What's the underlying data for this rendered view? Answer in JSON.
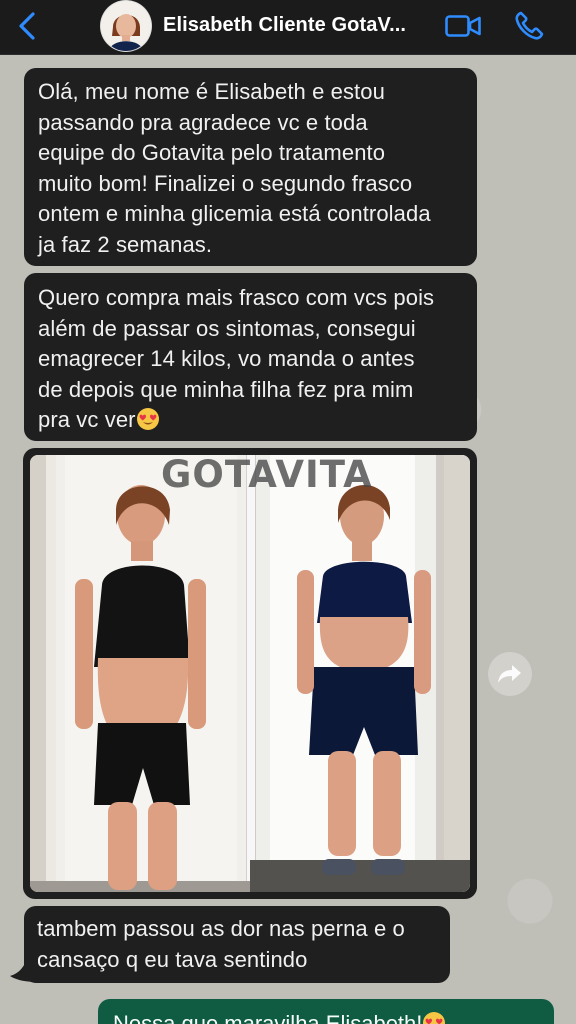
{
  "header": {
    "contact_name": "Elisabeth Cliente GotaV..."
  },
  "messages": {
    "m1": [
      "Olá, meu nome é Elisabeth e estou",
      "passando pra agradece vc e toda",
      "equipe do Gotavita pelo tratamento",
      "muito bom! Finalizei o segundo frasco",
      "ontem e minha glicemia está controlada",
      "ja faz 2 semanas."
    ],
    "m2": [
      "Quero compra mais frasco com vcs pois",
      "além de passar os sintomas, consegui",
      "emagrecer 14 kilos, vo manda o antes",
      "de depois que minha filha fez pra mim",
      "pra vc ver"
    ],
    "image_watermark": "GOTAVITA",
    "m3": [
      "tambem passou as dor nas perna e o",
      "cansaço q eu tava sentindo"
    ],
    "m4": "Nossa que maravilha Elisabeth!"
  },
  "icons": {
    "back": "chevron-left-icon",
    "video": "video-camera-icon",
    "phone": "phone-icon",
    "forward": "forward-icon",
    "emoji": "heart-eyes-emoji-icon"
  },
  "colors": {
    "header_bg": "#1b1b1b",
    "incoming_bubble": "#1f1f1f",
    "outgoing_bubble": "#0f5c43",
    "accent": "#2f8cff"
  }
}
